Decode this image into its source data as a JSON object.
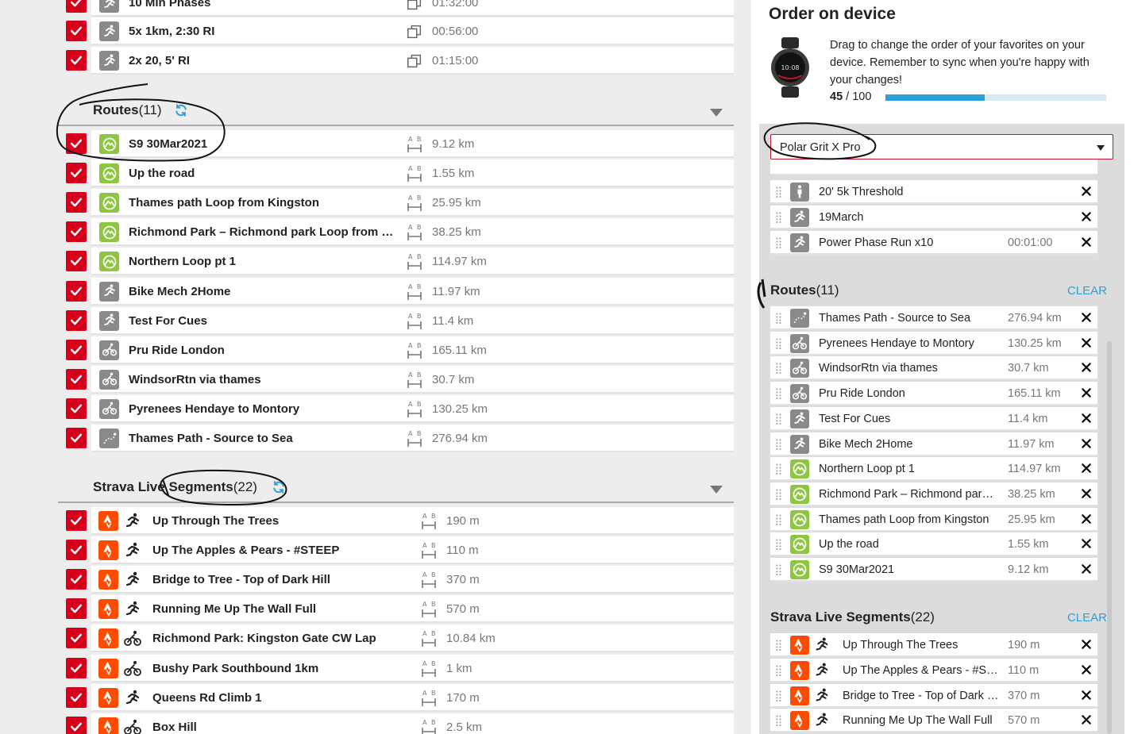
{
  "left": {
    "workouts": [
      {
        "name": "10 Min Phases",
        "value": "01:32:00"
      },
      {
        "name": "5x 1km, 2:30 RI",
        "value": "00:56:00"
      },
      {
        "name": "2x 20, 5' RI",
        "value": "01:15:00"
      }
    ],
    "routes_section": {
      "title": "Routes",
      "count": "(11)"
    },
    "routes": [
      {
        "name": "S9 30Mar2021",
        "value": "9.12 km",
        "icon": "route-green-icon"
      },
      {
        "name": "Up the road",
        "value": "1.55 km",
        "icon": "route-green-icon"
      },
      {
        "name": "Thames path Loop from Kingston",
        "value": "25.95 km",
        "icon": "route-green-icon"
      },
      {
        "name": "Richmond Park – Richmond park Loop from Kingst",
        "value": "38.25 km",
        "icon": "route-green-icon"
      },
      {
        "name": "Northern Loop pt 1",
        "value": "114.97 km",
        "icon": "route-green-icon"
      },
      {
        "name": "Bike Mech 2Home",
        "value": "11.97 km",
        "icon": "running-icon"
      },
      {
        "name": "Test For Cues",
        "value": "11.4 km",
        "icon": "running-icon"
      },
      {
        "name": "Pru Ride London",
        "value": "165.11 km",
        "icon": "cycling-icon"
      },
      {
        "name": "WindsorRtn via thames",
        "value": "30.7 km",
        "icon": "cycling-icon"
      },
      {
        "name": "Pyrenees Hendaye to Montory",
        "value": "130.25 km",
        "icon": "cycling-icon"
      },
      {
        "name": "Thames Path - Source to Sea",
        "value": "276.94 km",
        "icon": "dotted-route-icon"
      }
    ],
    "segments_section": {
      "title": "Strava Live Segments",
      "count": "(22)"
    },
    "segments": [
      {
        "name": "Up Through The Trees",
        "value": "190 m",
        "sport": "running-icon"
      },
      {
        "name": "Up The Apples & Pears - #STEEP",
        "value": "110 m",
        "sport": "running-icon"
      },
      {
        "name": "Bridge to Tree - Top of Dark Hill",
        "value": "370 m",
        "sport": "running-icon"
      },
      {
        "name": "Running Me Up The Wall Full",
        "value": "570 m",
        "sport": "running-icon"
      },
      {
        "name": "Richmond Park: Kingston Gate CW Lap",
        "value": "10.84 km",
        "sport": "cycling-icon"
      },
      {
        "name": "Bushy Park Southbound 1km",
        "value": "1 km",
        "sport": "cycling-icon"
      },
      {
        "name": "Queens Rd Climb 1",
        "value": "170 m",
        "sport": "running-icon"
      },
      {
        "name": "Box Hill",
        "value": "2.5 km",
        "sport": "cycling-icon"
      }
    ],
    "ab_label_a": "A",
    "ab_label_b": "B"
  },
  "right": {
    "title": "Order on device",
    "description": "Drag to change the order of your favorites on your device. Remember to sync when you're happy with your changes!",
    "usage_current": "45",
    "usage_total": " / 100",
    "usage_fraction": 0.45,
    "watch_time": "10:08",
    "device": "Polar Grit X Pro",
    "favorites": [
      {
        "name": "20' 5k Threshold",
        "value": "",
        "icon": "standing-person-icon"
      },
      {
        "name": "19March",
        "value": "",
        "icon": "running-icon"
      },
      {
        "name": "Power Phase Run x10",
        "value": "00:01:00",
        "icon": "running-icon"
      }
    ],
    "routes_section": {
      "title": "Routes",
      "count": "(11)",
      "clear": "CLEAR"
    },
    "routes": [
      {
        "name": "Thames Path - Source to Sea",
        "value": "276.94 km",
        "icon": "dotted-route-icon"
      },
      {
        "name": "Pyrenees Hendaye to Montory",
        "value": "130.25 km",
        "icon": "cycling-icon"
      },
      {
        "name": "WindsorRtn via thames",
        "value": "30.7 km",
        "icon": "cycling-icon"
      },
      {
        "name": "Pru Ride London",
        "value": "165.11 km",
        "icon": "cycling-icon"
      },
      {
        "name": "Test For Cues",
        "value": "11.4 km",
        "icon": "running-icon"
      },
      {
        "name": "Bike Mech 2Home",
        "value": "11.97 km",
        "icon": "running-icon"
      },
      {
        "name": "Northern Loop pt 1",
        "value": "114.97 km",
        "icon": "route-green-icon"
      },
      {
        "name": "Richmond Park – Richmond park Loop",
        "value": "38.25 km",
        "icon": "route-green-icon"
      },
      {
        "name": "Thames path Loop from Kingston",
        "value": "25.95 km",
        "icon": "route-green-icon"
      },
      {
        "name": "Up the road",
        "value": "1.55 km",
        "icon": "route-green-icon"
      },
      {
        "name": "S9 30Mar2021",
        "value": "9.12 km",
        "icon": "route-green-icon"
      }
    ],
    "segments_section": {
      "title": "Strava Live Segments",
      "count": "(22)",
      "clear": "CLEAR"
    },
    "segments": [
      {
        "name": "Up Through The Trees",
        "value": "190 m",
        "sport": "running-icon"
      },
      {
        "name": "Up The Apples & Pears - #STEEP",
        "value": "110 m",
        "sport": "running-icon"
      },
      {
        "name": "Bridge to Tree - Top of Dark Hill",
        "value": "370 m",
        "sport": "running-icon"
      },
      {
        "name": "Running Me Up The Wall Full",
        "value": "570 m",
        "sport": "running-icon"
      }
    ]
  },
  "colors": {
    "checkbox_red": "#d6001c",
    "route_green": "#8dc63f",
    "strava_orange": "#fc4c02",
    "accent_blue": "#2e9fd8",
    "icon_grey": "#8a8a8a"
  }
}
